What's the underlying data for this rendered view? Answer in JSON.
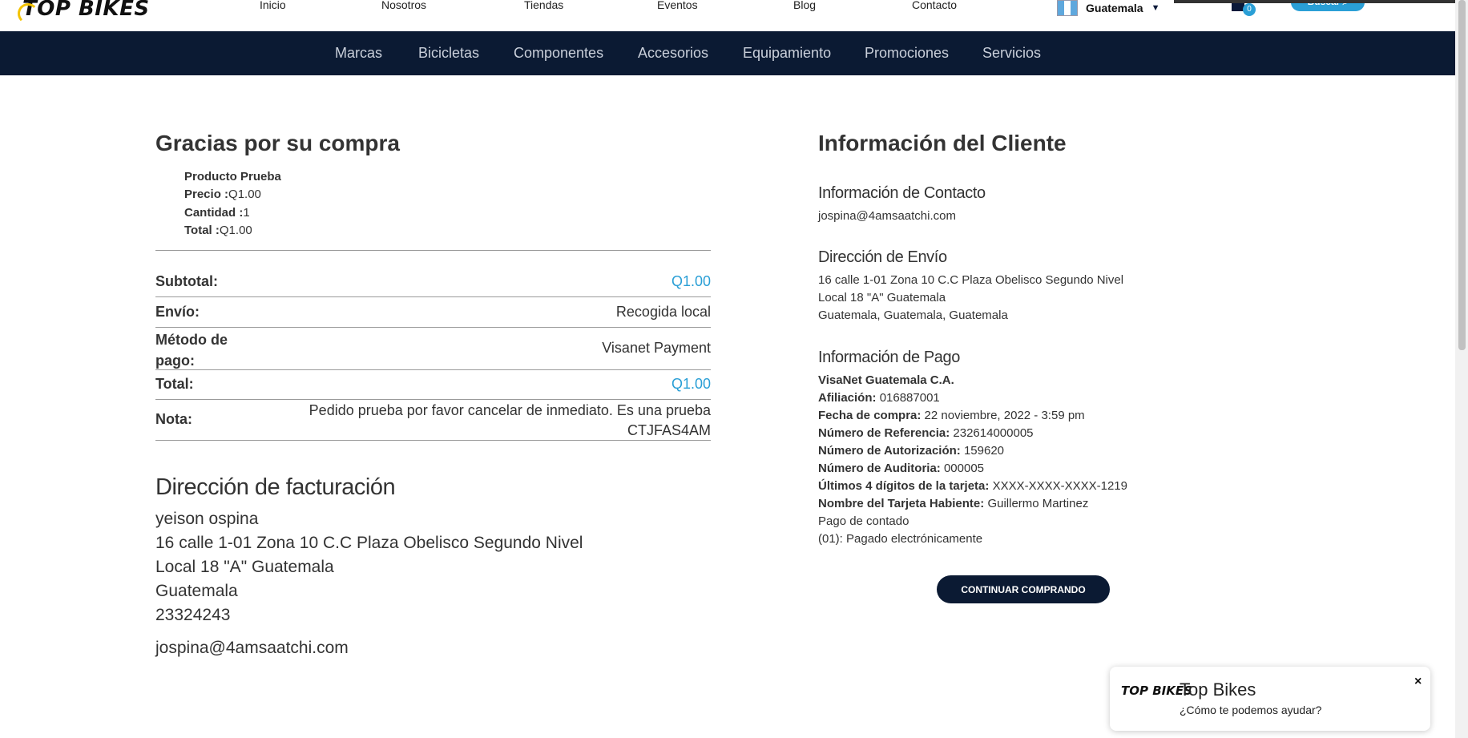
{
  "header": {
    "logo_text": "TOP BIKES",
    "nav": [
      "Inicio",
      "Nosotros",
      "Tiendas",
      "Eventos",
      "Blog",
      "Contacto"
    ],
    "country": "Guatemala",
    "cart_count": "0",
    "search_label": "Buscar"
  },
  "categories": [
    "Marcas",
    "Bicicletas",
    "Componentes",
    "Accesorios",
    "Equipamiento",
    "Promociones",
    "Servicios"
  ],
  "order": {
    "title": "Gracias por su compra",
    "product_name": "Producto Prueba",
    "price_label": "Precio :",
    "price": "Q1.00",
    "qty_label": "Cantidad :",
    "qty": "1",
    "total_label": "Total :",
    "total": "Q1.00",
    "subtotal_label": "Subtotal:",
    "subtotal": "Q1.00",
    "shipping_label": "Envío:",
    "shipping": "Recogida local",
    "payment_label_1": "Método de",
    "payment_label_2": "pago:",
    "payment": "Visanet Payment",
    "grand_total_label": "Total:",
    "grand_total": "Q1.00",
    "note_label": "Nota:",
    "note_line1": "Pedido prueba por favor cancelar de inmediato. Es una prueba",
    "note_line2": "CTJFAS4AM"
  },
  "billing": {
    "title": "Dirección de facturación",
    "name": "yeison ospina",
    "address1": "16 calle 1-01 Zona 10 C.C Plaza Obelisco Segundo Nivel",
    "address2": "Local 18 \"A\" Guatemala",
    "city": "Guatemala",
    "phone": "23324243",
    "email": "jospina@4amsaatchi.com"
  },
  "customer": {
    "title": "Información del Cliente",
    "contact_title": "Información de Contacto",
    "contact_email": "jospina@4amsaatchi.com",
    "shipping_title": "Dirección de Envío",
    "ship_line1": "16 calle 1-01 Zona 10 C.C Plaza Obelisco Segundo Nivel",
    "ship_line2": "Local 18 \"A\" Guatemala",
    "ship_line3": "Guatemala, Guatemala, Guatemala",
    "payment_title": "Información de Pago",
    "processor": "VisaNet Guatemala C.A.",
    "affiliation_label": "Afiliación:",
    "affiliation": "016887001",
    "date_label": "Fecha de compra:",
    "date": "22 noviembre, 2022 - 3:59 pm",
    "ref_label": "Número de Referencia:",
    "ref": "232614000005",
    "auth_label": "Número de Autorización:",
    "auth": "159620",
    "audit_label": "Número de Auditoria:",
    "audit": "000005",
    "card_label": "Últimos 4 dígitos de la tarjeta:",
    "card": "XXXX-XXXX-XXXX-1219",
    "holder_label": "Nombre del Tarjeta Habiente:",
    "holder": "Guillermo Martinez",
    "pay_type": "Pago de contado",
    "pay_status": "(01): Pagado electrónicamente",
    "continue_label": "CONTINUAR COMPRANDO"
  },
  "chat": {
    "logo_text": "TOP BIKES",
    "title": "Top Bikes",
    "subtitle": "¿Cómo te podemos ayudar?",
    "close": "×"
  },
  "colors": {
    "navy": "#0b1a33",
    "accent": "#2a9fd6",
    "logo_yellow": "#f3c300"
  }
}
